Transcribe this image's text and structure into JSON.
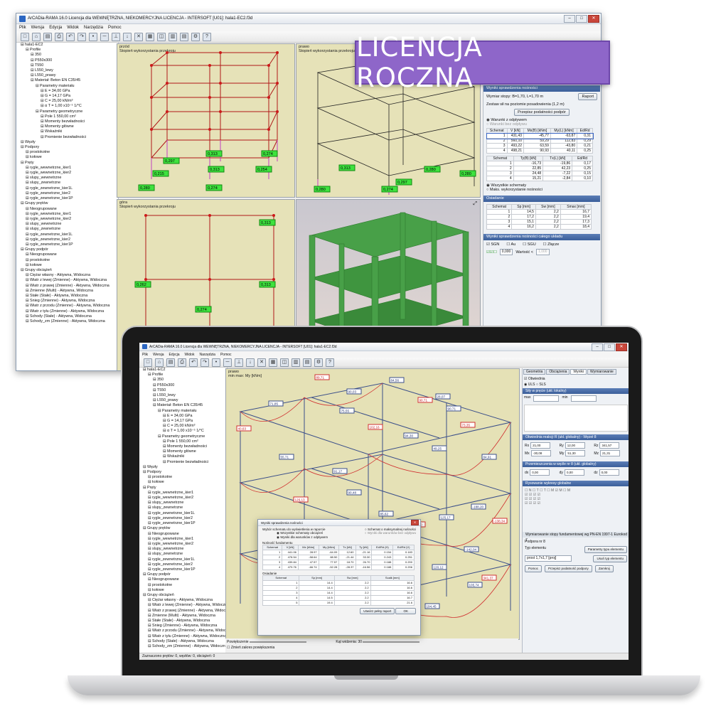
{
  "banner": {
    "text": "LICENCJA ROCZNA",
    "color": "#8e66c9"
  },
  "back_window": {
    "title": "ArCADia-RAMA 16.0 Licencja dla WEWNĘTRZNA, NIEKOMERCYJNA LICENCJA - INTERSOFT [U01]: hala1-EC2.f3d",
    "menu": [
      "Plik",
      "Wersja",
      "Edycja",
      "Widok",
      "Narzędzia",
      "Pomoc"
    ],
    "tree": [
      "hala1-EC2",
      "Profile",
      "350",
      "P550x300",
      "T550",
      "L550_lewy",
      "L550_prawy",
      "Materiał: Beton EN C35/45",
      "Parametry materiału",
      "E = 34,00 GPa",
      "G = 14,17 GPa",
      "C = 25,00 kN/m³",
      "α T = 1,00 x10⁻⁵ 1/°C",
      "Parametry geometryczne",
      "Pole 1 550,00 cm²",
      "Momenty bezwładności",
      "Momenty główne",
      "Wskaźniki",
      "Promienie bezwładności",
      "Węzły",
      "Podpory",
      "prostokotne",
      "kołowe",
      "Pręty",
      "rygle_wewnetrzne_kier1",
      "rygle_wewnetrzne_kier2",
      "slupy_wewnetrzne",
      "slupy_zewnetrzne",
      "rygle_zewnetrzne_kier1L",
      "rygle_zewnetrzne_kier2",
      "rygle_zewnetrzne_kier1P",
      "Grupy prętów",
      "Nieogrupowane",
      "rygle_wewnetrzne_kier1",
      "rygle_wewnetrzne_kier2",
      "slupy_wewnetrzne",
      "slupy_zewnetrzne",
      "rygle_zewnetrzne_kier1L",
      "rygle_zewnetrzne_kier2",
      "rygle_zewnetrzne_kier1P",
      "Grupy podpór",
      "Nieogrupowane",
      "prostokotne",
      "kołowe",
      "Grupy obciążeń",
      "Ciężar własny - Aktywna, Widoczna",
      "Wiatr z lewej (Zmienne) - Aktywna, Widoczna",
      "Wiatr z prawej (Zmienne) - Aktywna, Widoczna",
      "Zmienne (Multi) - Aktywna, Widoczna",
      "Stałe (Stałe) - Aktywna, Widoczna",
      "Śnieg (Zmienne) - Aktywna, Widoczna",
      "Wiatr z przodu (Zmienne) - Aktywna, Widoczna",
      "Wiatr z tyłu (Zmienne) - Aktywna, Widoczna",
      "Schody (Stałe) - Aktywna, Widoczna",
      "Schody_zm (Zmienne) - Aktywna, Widoczna"
    ],
    "views": {
      "przod": {
        "name": "przód",
        "sub": "Stopień wykorzystania przekroju",
        "values": [
          "0,297",
          "0,313",
          "0,254",
          "0,215",
          "0,313",
          "0,274",
          "0,280",
          "0,274"
        ]
      },
      "prawo": {
        "name": "prawo",
        "sub": "Stopień wykorzystania przekroju",
        "values": [
          "0,313",
          "0,280",
          "0,297",
          "0,280",
          "0,280",
          "0,274"
        ]
      },
      "gora": {
        "name": "góra",
        "sub": "Stopień wykorzystania przekroju",
        "values": [
          "0,262",
          "0,274",
          "0,313",
          "0,313"
        ]
      }
    },
    "panel": {
      "header": "Wyniki sprawdzenia nośności",
      "wymiar": "Wymiar stopy: B=1,70, L=1,70 m",
      "raport": "Raport",
      "zestaw": "Zestaw sił na poziomie posadowienia (1,2 m)",
      "przepisz": "Przepisz podatności podpór",
      "warunki": "Warunki z odpływem",
      "warunki_bez": "Warunki bez odpływu",
      "t1_head": [
        "Schemat",
        "V [kN]",
        "Mx(B) [kNm]",
        "My(L) [kNm]",
        "Ed/Rd"
      ],
      "t1_rows": [
        [
          "1",
          "431,43",
          "-45,77",
          "-63,87",
          "0,31"
        ],
        [
          "2",
          "560,10",
          "59,29",
          "112,83",
          "0,29"
        ],
        [
          "3",
          "493,22",
          "63,59",
          "-43,80",
          "0,21"
        ],
        [
          "4",
          "498,21",
          "90,93",
          "40,11",
          "0,25"
        ]
      ],
      "t2_head": [
        "Schemat",
        "Ty(B) [kN]",
        "Tx(L) [kN]",
        "Ed/Rd"
      ],
      "t2_rows": [
        [
          "1",
          "-16,73",
          "-19,86",
          "0,17"
        ],
        [
          "2",
          "22,85",
          "42,23",
          "0,25"
        ],
        [
          "3",
          "24,48",
          "-7,22",
          "0,15"
        ],
        [
          "4",
          "15,21",
          "-2,84",
          "0,10"
        ]
      ],
      "wszystkie": "Wszystkie schematy",
      "maks": "Maks. wykorzystanie nośności",
      "osiadanie": "Osiadanie",
      "t3_head": [
        "Schemat",
        "Sp [mm]",
        "Sw [mm]",
        "Smax [mm]"
      ],
      "t3_rows": [
        [
          "1",
          "14,5",
          "2,2",
          "16,7"
        ],
        [
          "2",
          "17,2",
          "2,2",
          "19,4"
        ],
        [
          "3",
          "15,1",
          "2,2",
          "17,3"
        ],
        [
          "4",
          "16,2",
          "2,2",
          "18,4"
        ]
      ],
      "wyniki_ukl": "Wyniki sprawdzenia nośności całego układu",
      "sgn": "SGN",
      "au": "Au",
      "sgu": "SGU",
      "zlacze": "Złącze",
      "wartosc_lbl": "Wartość <",
      "wartosc1": "0,000",
      "wartosc2": "1,000"
    }
  },
  "front_window": {
    "title": "ArCADia-RAMA 16.0 Licencja dla WEWNĘTRZNA, NIEKOMERCYJNA LICENCJA - INTERSOFT [U01]: hala1-EC2.f3d",
    "menu": [
      "Plik",
      "Wersja",
      "Edycja",
      "Widok",
      "Narzędzia",
      "Pomoc"
    ],
    "view_name": "prawo",
    "view_sub": "min max: My [kNm]",
    "labels": [
      "89,71",
      "90,03",
      "84,56",
      "90,71",
      "90,71",
      "71,85",
      "40,63",
      "55,71",
      "75,55",
      "102,16",
      "94,30",
      "49,25",
      "73,35",
      "84,91",
      "91,17",
      "126,13",
      "90,48",
      "85,62",
      "108,30",
      "125,17",
      "-188,20",
      "104,27",
      "97,12",
      "203,70",
      "143,60",
      "120,12",
      "-142,04",
      "-138,34",
      "38,42",
      "105,74",
      "158,20",
      "194,45",
      "28,07",
      "341,37",
      "-62,21"
    ],
    "tabs": [
      "Geometria",
      "Obciążenia",
      "Wyniki",
      "Wymiarowanie"
    ],
    "obwiednia": "Obwiednia",
    "uls": "ULS",
    "sls": "SLS",
    "sily_head": "Siły w pręcie (ukł. lokalny)",
    "max": "max",
    "min": "min",
    "reakcje_head": "Obwiednia reakcji R (ukł. globalny) - Węzeł 8",
    "reakcje": [
      [
        "Rx",
        "21,00"
      ],
      [
        "Ry",
        "12,00"
      ],
      [
        "Rz",
        "341,57"
      ],
      [
        "Mx",
        "-30,08"
      ],
      [
        "My",
        "51,30"
      ],
      [
        "Mz",
        "21,31"
      ]
    ],
    "przem_head": "Przemieszczenia w węźle nr 8 (ukł. globalny)",
    "przem": [
      [
        "dx",
        "0,00"
      ],
      [
        "dy",
        "0,00"
      ],
      [
        "dz",
        "0,00"
      ]
    ],
    "rys_head": "Rysowanie wykresy globalne",
    "wym_head": "Wymiarowanie stopy fundamentowej wg PN-EN 1997-1 Eurokod 7",
    "podpora": "Podpora nr 8",
    "typ_lbl": "Typ elementu",
    "typ_val": "prost 1,7x1,7 [proj]",
    "param_btn": "Parametry typu elementu",
    "usun_btn": "Usuń typ elementu",
    "pomoc_btn": "Pomoc",
    "przepisz_btn": "Przepisz podatność podpory",
    "zamknij_btn": "Zamknij",
    "powiekszenie": "Powiększenie",
    "kat": "Kąt widzenia: 30",
    "zmien": "Zmień zakres powiększenia",
    "status": "Zaznaczono prętów: 0, węzłów: 0, obciążeń: 0",
    "dialog": {
      "title": "Wyniki sprawdzenia nośności",
      "wybor": "Wybór schematu do wyświetlenia w raporcie",
      "opt1": "Wszystkie schematy obciążeń",
      "opt2": "Schemat o maksymalnej nośności",
      "opt3": "Wyniki dla warunków z odpływem",
      "opt4": "Wyniki dla warunków bez odpływu",
      "nosnosc": "Nośność fundamentu",
      "t1_head": [
        "Schemat",
        "V [kN]",
        "Mx [kNm]",
        "My [kNm]",
        "Tx [kN]",
        "Ty [kN]",
        "Ed/Rd (H)",
        "Ed/Rd (V)"
      ],
      "t1_rows": [
        [
          "1",
          "441.06",
          "28.97",
          "-64.09",
          "12.60",
          "-21.16",
          "0.154",
          "0.183"
        ],
        [
          "2",
          "478.54",
          "-58.64",
          "88.50",
          "-21.44",
          "33.30",
          "0.243",
          "0.251"
        ],
        [
          "3",
          "439.84",
          "47.57",
          "77.57",
          "18.70",
          "26.70",
          "0.188",
          "0.200"
        ],
        [
          "4",
          "479.76",
          "-66.74",
          "-52.28",
          "-28.37",
          "-16.56",
          "0.188",
          "0.206"
        ]
      ],
      "osiadanie": "Osiadanie",
      "t2_head": [
        "Schemat",
        "Sp [mm]",
        "Sw [mm]",
        "Scałk [mm]"
      ],
      "t2_rows": [
        [
          "1",
          "14.4",
          "2.2",
          "16.6"
        ],
        [
          "2",
          "14.4",
          "2.2",
          "16.6"
        ],
        [
          "3",
          "14.4",
          "2.2",
          "16.6"
        ],
        [
          "4",
          "14.5",
          "2.2",
          "16.7"
        ],
        [
          "5",
          "19.4",
          "2.2",
          "21.6"
        ]
      ],
      "utworz": "Utwórz pełny raport",
      "ok": "OK"
    }
  }
}
